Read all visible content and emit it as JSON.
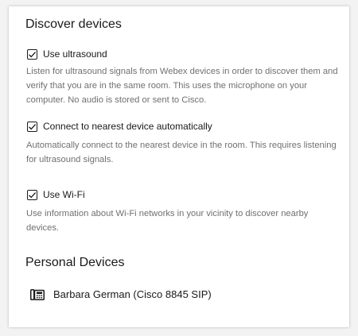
{
  "discover": {
    "title": "Discover devices",
    "options": [
      {
        "label": "Use ultrasound",
        "checked": true,
        "description": "Listen for ultrasound signals from Webex devices in order to discover them and verify that you are in the same room. This uses the microphone on your computer. No audio is stored or sent to Cisco."
      },
      {
        "label": "Connect to nearest device automatically",
        "checked": true,
        "description": "Automatically connect to the nearest device in the room. This requires listening for ultrasound signals."
      },
      {
        "label": "Use Wi-Fi",
        "checked": true,
        "description": "Use information about Wi-Fi networks in your vicinity to discover nearby devices."
      }
    ]
  },
  "personal_devices": {
    "title": "Personal Devices",
    "items": [
      {
        "icon": "desk-phone-icon",
        "label": "Barbara German (Cisco 8845 SIP)"
      }
    ]
  }
}
